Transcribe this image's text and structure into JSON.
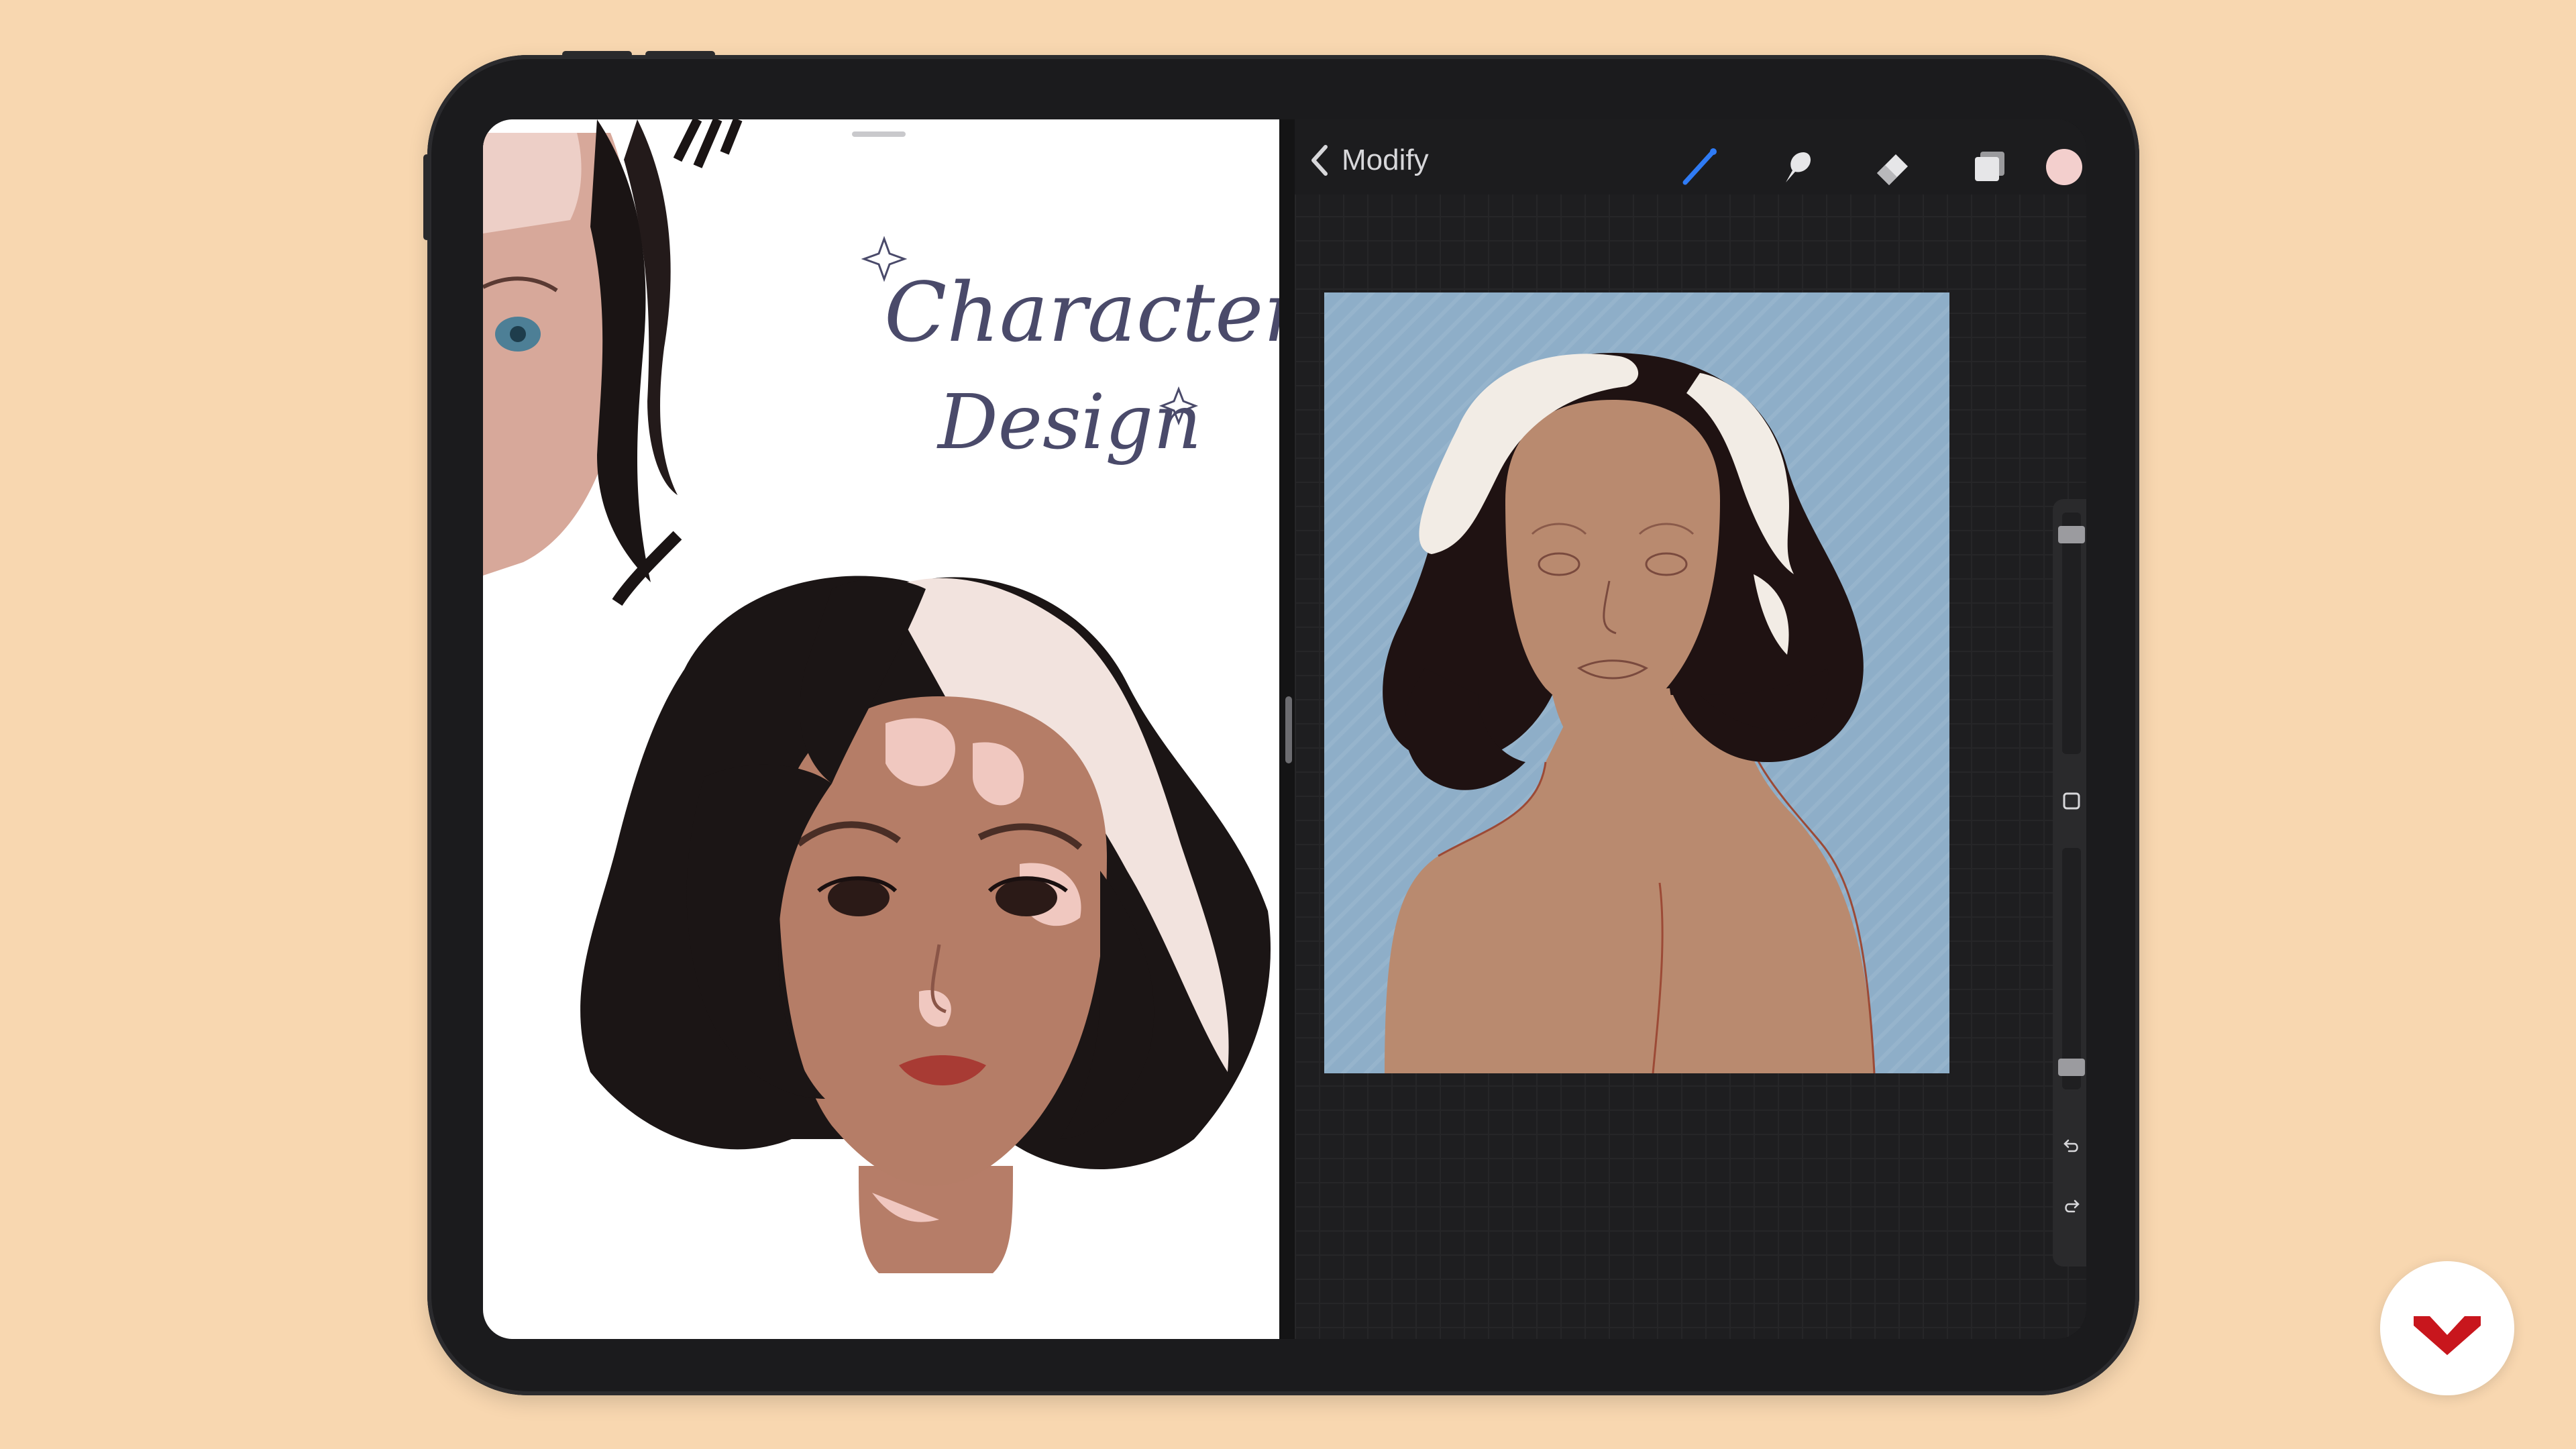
{
  "left_pane": {
    "title_line1": "Character",
    "title_line2": "Design"
  },
  "procreate": {
    "back_label": "Modify",
    "tools": [
      "brush-icon",
      "smudge-icon",
      "eraser-icon",
      "layers-icon"
    ],
    "active_tool": "brush-icon",
    "current_color": "#f3cfcd",
    "accent": "#2f7bf5"
  },
  "brand": {
    "logo_color": "#c8161d"
  }
}
